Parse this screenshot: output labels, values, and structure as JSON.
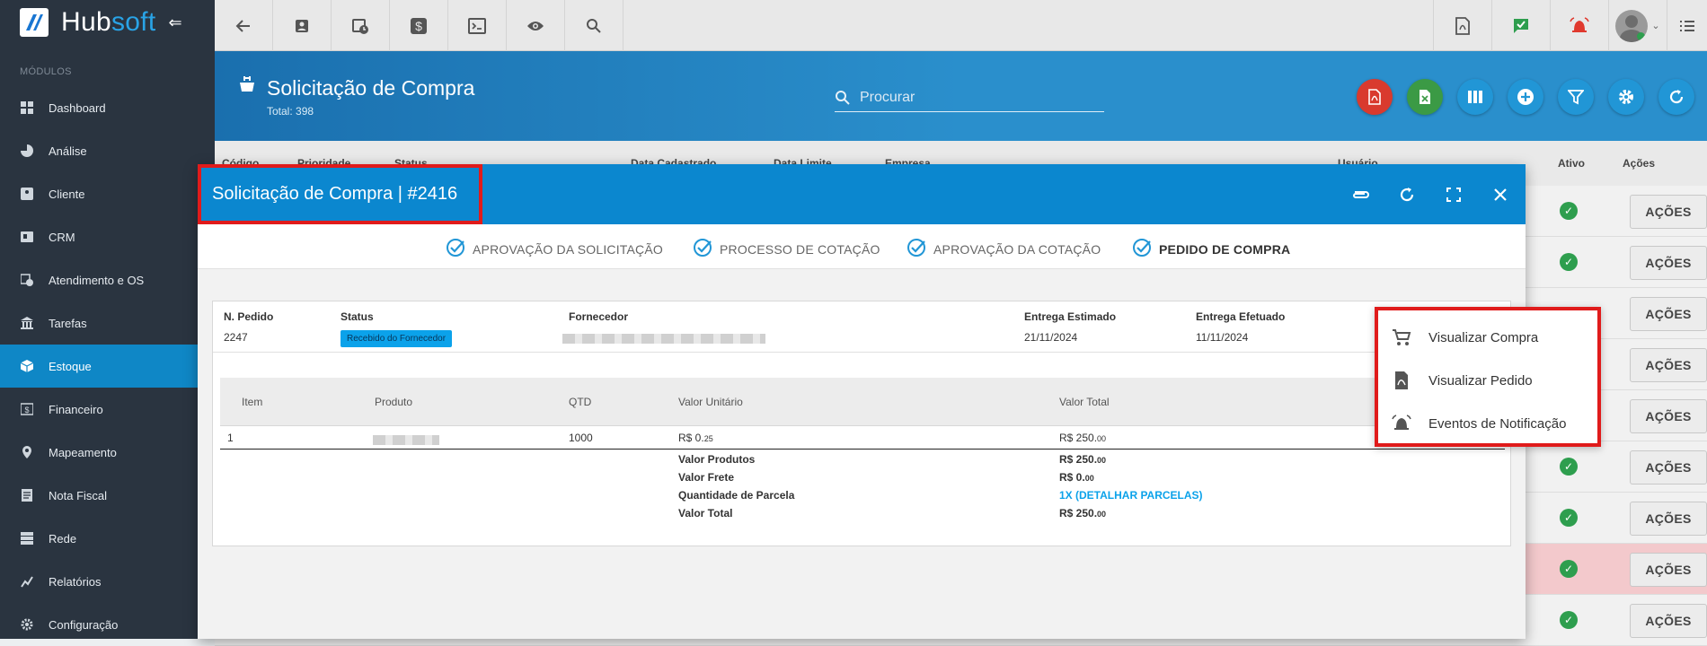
{
  "brand": {
    "part1": "Hub",
    "part2": "soft",
    "collapse": "⇐"
  },
  "sidebar": {
    "section": "MÓDULOS",
    "items": [
      {
        "label": "Dashboard",
        "icon": "grid-icon"
      },
      {
        "label": "Análise",
        "icon": "pie-icon"
      },
      {
        "label": "Cliente",
        "icon": "contact-icon",
        "chevron": "›"
      },
      {
        "label": "CRM",
        "icon": "crm-icon"
      },
      {
        "label": "Atendimento e OS",
        "icon": "calendar-clock-icon"
      },
      {
        "label": "Tarefas",
        "icon": "bank-icon"
      },
      {
        "label": "Estoque",
        "icon": "box-icon"
      },
      {
        "label": "Financeiro",
        "icon": "money-icon"
      },
      {
        "label": "Mapeamento",
        "icon": "pin-icon"
      },
      {
        "label": "Nota Fiscal",
        "icon": "doc-icon"
      },
      {
        "label": "Rede",
        "icon": "server-icon"
      },
      {
        "label": "Relatórios",
        "icon": "chart-icon"
      },
      {
        "label": "Configuração",
        "icon": "gear-icon",
        "chevron": "›"
      }
    ]
  },
  "page": {
    "title": "Solicitação de Compra",
    "total": "Total: 398",
    "search_placeholder": "Procurar"
  },
  "table_head": {
    "codigo": "Código",
    "prioridade": "Prioridade",
    "status": "Status",
    "data_cadastrado": "Data Cadastrado",
    "data_limite": "Data Limite",
    "empresa": "Empresa",
    "usuario": "Usuário",
    "ativo": "Ativo",
    "acoes": "Ações"
  },
  "acoes_label": "AÇÕES",
  "modal": {
    "title": "Solicitação de Compra | #2416",
    "steps": [
      "APROVAÇÃO DA SOLICITAÇÃO",
      "PROCESSO DE COTAÇÃO",
      "APROVAÇÃO DA COTAÇÃO",
      "PEDIDO DE COMPRA"
    ],
    "order": {
      "n_pedido_label": "N. Pedido",
      "n_pedido": "2247",
      "status_label": "Status",
      "status": "Recebido do Fornecedor",
      "fornecedor_label": "Fornecedor",
      "entrega_est_label": "Entrega Estimado",
      "entrega_est": "21/11/2024",
      "entrega_ef_label": "Entrega Efetuado",
      "entrega_ef": "11/11/2024"
    },
    "items_head": {
      "item": "Item",
      "produto": "Produto",
      "qtd": "QTD",
      "valor_unitario": "Valor Unitário",
      "valor_total": "Valor Total"
    },
    "items": [
      {
        "item": "1",
        "qtd": "1000",
        "vu_main": "R$ 0.",
        "vu_dec": "25",
        "vt_main": "R$ 250.",
        "vt_dec": "00"
      }
    ],
    "summary": {
      "produtos_label": "Valor Produtos",
      "produtos_main": "R$ 250.",
      "produtos_dec": "00",
      "frete_label": "Valor Frete",
      "frete_main": "R$ 0.",
      "frete_dec": "00",
      "parcela_label": "Quantidade de Parcela",
      "parcela": "1X (DETALHAR PARCELAS)",
      "total_label": "Valor Total",
      "total_main": "R$ 250.",
      "total_dec": "00"
    }
  },
  "menu": {
    "items": [
      "Visualizar Compra",
      "Visualizar Pedido",
      "Eventos de Notificação"
    ]
  },
  "colors": {
    "sidebar": "#2a3440",
    "active": "#0f87c6",
    "header": "#2a8fcc",
    "modal_head": "#0b87cf",
    "highlight": "#e01b1b",
    "pdf": "#d93a2e",
    "excel": "#3b9a45",
    "round_blue": "#2196d6"
  }
}
